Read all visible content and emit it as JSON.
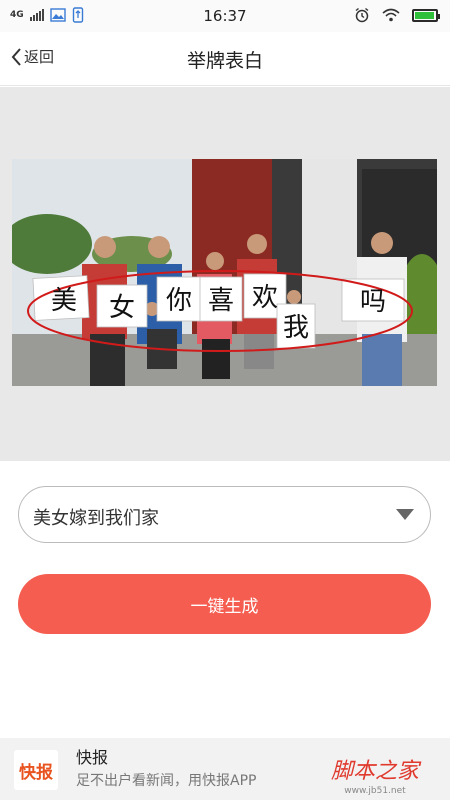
{
  "status_bar": {
    "network": "4G",
    "time": "16:37",
    "battery_level": 0.95,
    "icons": [
      "signal-icon",
      "image-icon",
      "usb-icon",
      "alarm-icon",
      "wifi-icon",
      "battery-icon"
    ]
  },
  "nav": {
    "back_label": "返回",
    "title": "举牌表白"
  },
  "sign_image": {
    "sign_text": [
      "美",
      "女",
      "你",
      "喜",
      "欢",
      "我",
      "吗"
    ]
  },
  "form": {
    "selected_phrase": "美女嫁到我们家",
    "generate_label": "一键生成"
  },
  "ad": {
    "logo_text": "快报",
    "title": "快报",
    "subtitle": "足不出户看新闻，用快报APP",
    "watermark": "脚本之家",
    "watermark_url": "www.jb51.net"
  },
  "colors": {
    "accent": "#f45d4f",
    "background_gray": "#e8e8e8",
    "battery_green": "#2fbf3a"
  }
}
